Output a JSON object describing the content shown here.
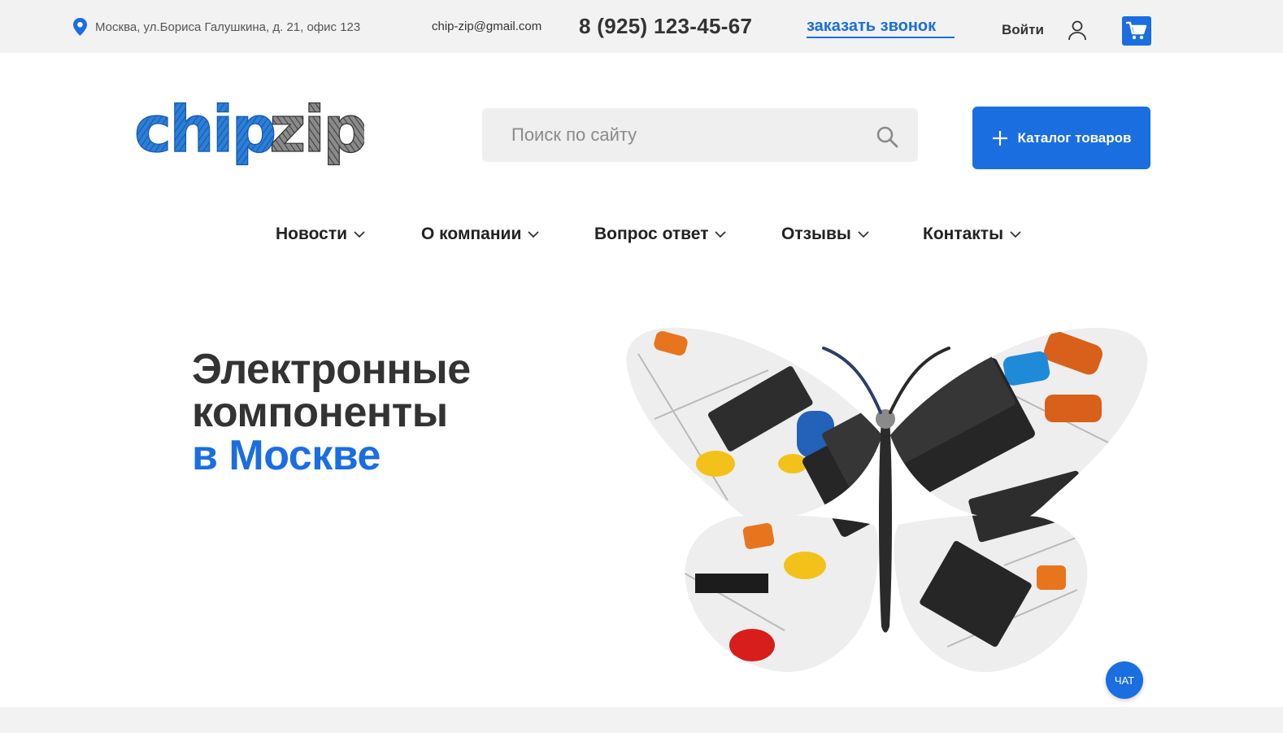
{
  "topbar": {
    "address": "Москва, ул.Бориса Галушкина, д. 21, офис 123",
    "email": "chip-zip@gmail.com",
    "phone": "8 (925) 123-45-67",
    "callback_label": "заказать звонок",
    "login_label": "Войти",
    "icons": {
      "address": "map-pin-icon",
      "user": "user-icon",
      "cart": "cart-icon"
    }
  },
  "header": {
    "logo": "chipzip",
    "search": {
      "placeholder": "Поиск по сайту",
      "value": ""
    },
    "catalog_label": "Каталог товаров"
  },
  "nav": {
    "items": [
      {
        "label": "Новости"
      },
      {
        "label": "О компании"
      },
      {
        "label": "Вопрос ответ"
      },
      {
        "label": "Отзывы"
      },
      {
        "label": "Контакты"
      }
    ]
  },
  "hero": {
    "title_line1": "Электронные",
    "title_line2": "компоненты",
    "title_accent": "в Москве"
  },
  "chat": {
    "label": "ЧАТ"
  },
  "colors": {
    "accent": "#1a6ee0",
    "topbar_bg": "#f2f2f2",
    "text": "#222222"
  }
}
